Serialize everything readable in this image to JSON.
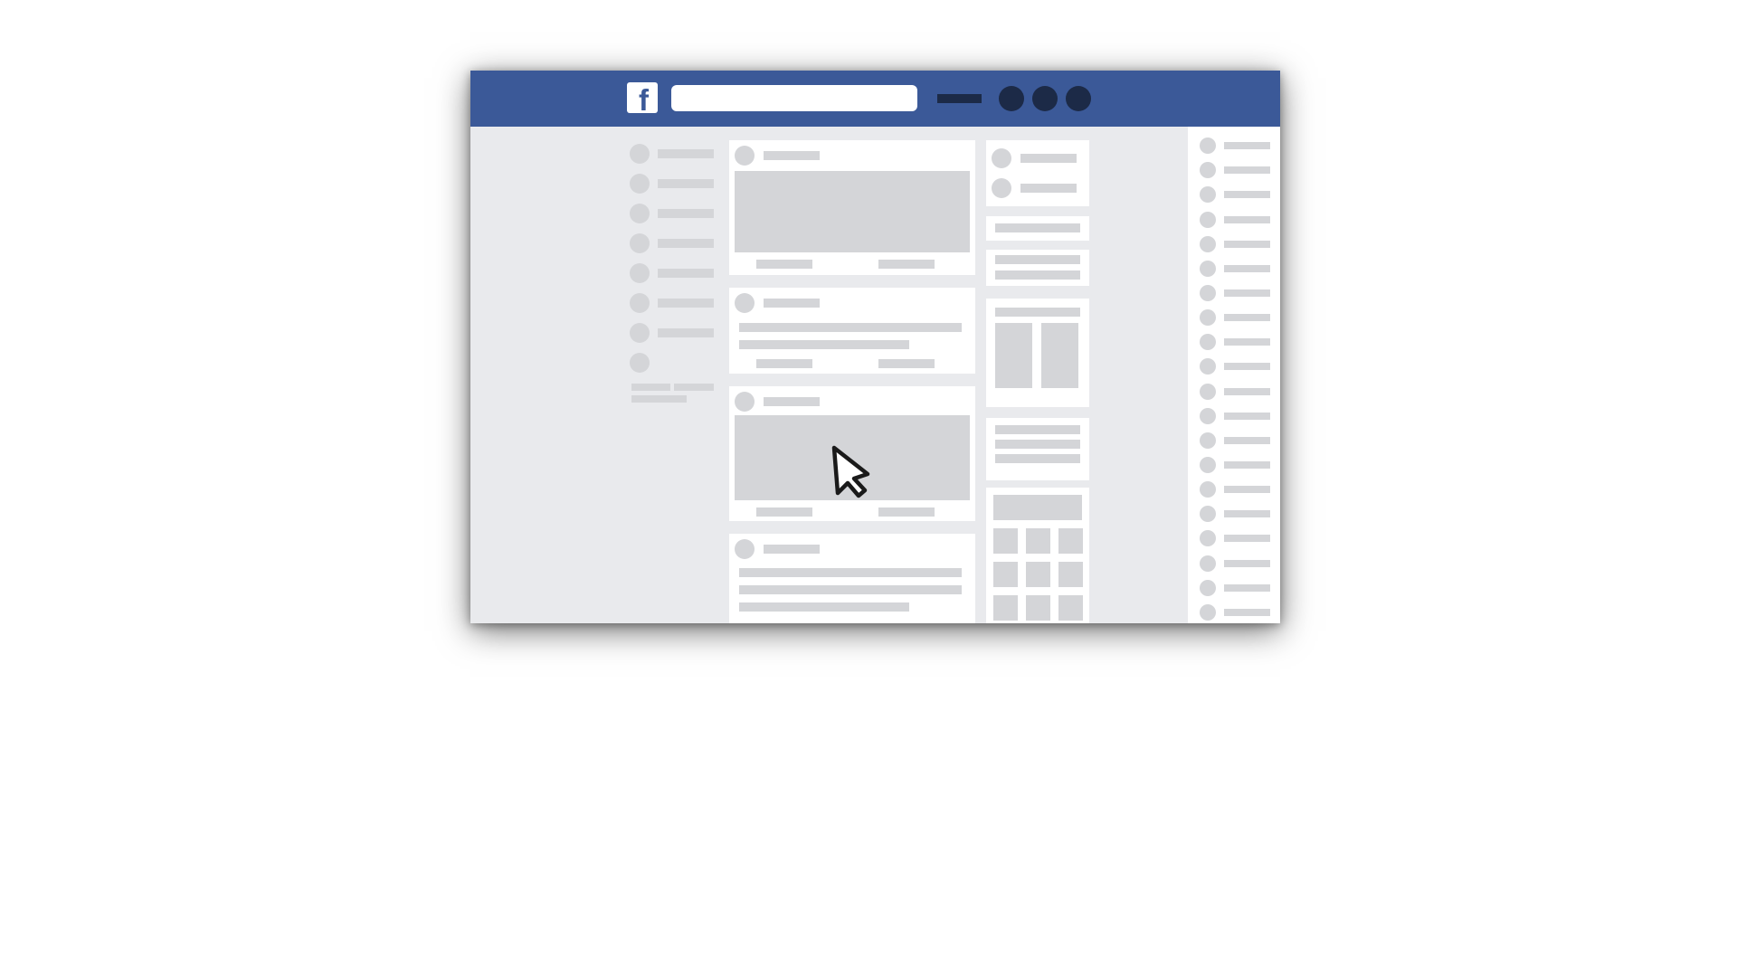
{
  "app": {
    "name": "Facebook",
    "logo_glyph": "f"
  },
  "colors": {
    "brand": "#3b5998",
    "brand_dark": "#1c2a47",
    "page_background": "#e9eaed",
    "placeholder": "#d4d5d8",
    "card": "#ffffff"
  },
  "header": {
    "search": {
      "value": "",
      "placeholder": ""
    },
    "icons": [
      "menu-icon",
      "friend-requests-icon",
      "messages-icon",
      "notifications-icon"
    ]
  },
  "left_nav": {
    "item_count": 8
  },
  "feed": {
    "posts": [
      {
        "type": "image-post"
      },
      {
        "type": "text-post"
      },
      {
        "type": "image-post"
      },
      {
        "type": "text-post"
      }
    ]
  },
  "right_widgets": {
    "widget_count": 6
  },
  "chat_sidebar": {
    "contact_count": 20
  },
  "cursor": {
    "icon": "arrow-pointer-icon"
  }
}
